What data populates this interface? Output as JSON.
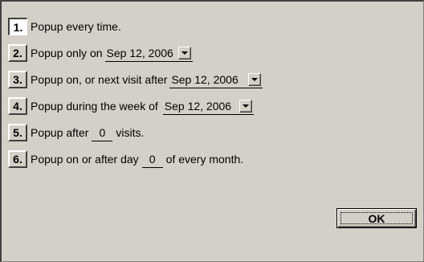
{
  "options": [
    {
      "number": "1.",
      "text": "Popup every time."
    },
    {
      "number": "2.",
      "text": "Popup only on",
      "date": "Sep 12, 2006"
    },
    {
      "number": "3.",
      "text": "Popup on, or next visit after",
      "date": "Sep 12, 2006"
    },
    {
      "number": "4.",
      "text": "Popup during the week of",
      "date": "Sep 12, 2006"
    },
    {
      "number": "5.",
      "text_before": "Popup after",
      "value": "0",
      "text_after": "visits."
    },
    {
      "number": "6.",
      "text_before": "Popup on or after day",
      "value": "0",
      "text_after": "of every month."
    }
  ],
  "selected_option": "1.",
  "ok_label": "OK"
}
